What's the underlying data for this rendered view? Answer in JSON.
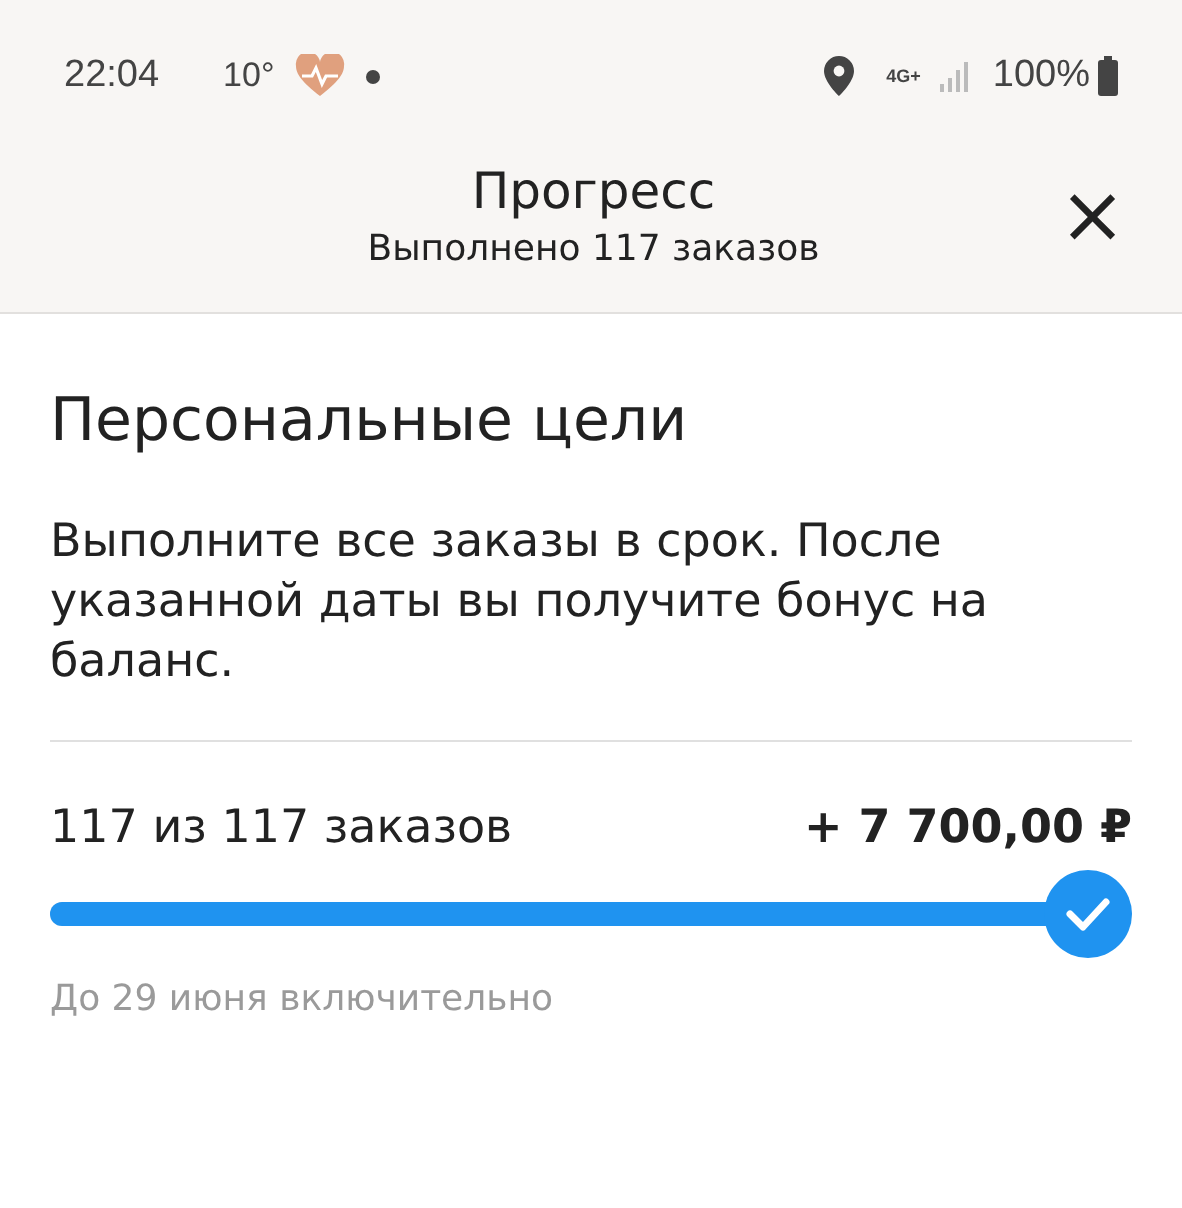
{
  "status_bar": {
    "time": "22:04",
    "temperature": "10°",
    "network": "4G+",
    "battery": "100%"
  },
  "header": {
    "title": "Прогресс",
    "subtitle": "Выполнено 117 заказов",
    "close": "×"
  },
  "goal": {
    "heading": "Персональные цели",
    "description": "Выполните все заказы в срок. После указанной даты вы получите бонус на баланс.",
    "count": "117 из 117 заказов",
    "bonus": "+ 7 700,00 ₽",
    "level": 1,
    "completed": true,
    "deadline": "До 29 июня включительно"
  }
}
